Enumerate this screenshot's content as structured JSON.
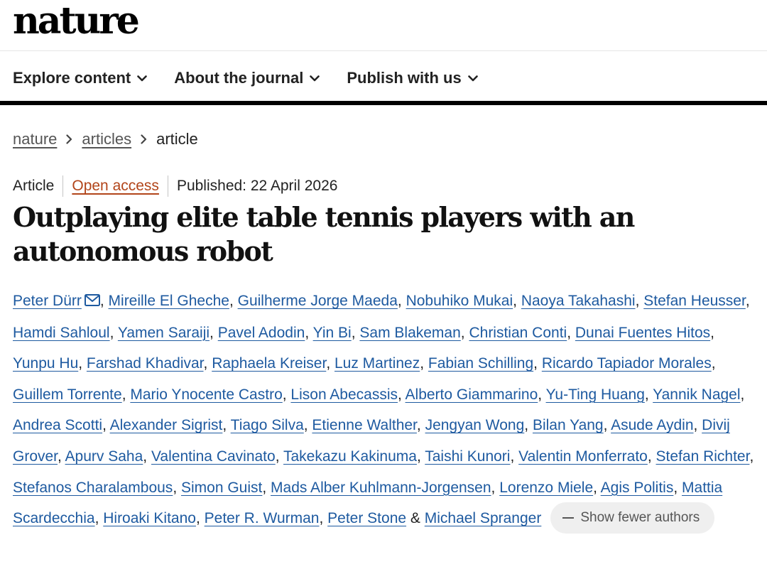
{
  "header": {
    "logo": "nature"
  },
  "nav": {
    "items": [
      {
        "label": "Explore content",
        "icon": "chevron-down-icon"
      },
      {
        "label": "About the journal",
        "icon": "chevron-down-icon"
      },
      {
        "label": "Publish with us",
        "icon": "chevron-down-icon"
      }
    ]
  },
  "breadcrumb": [
    {
      "label": "nature",
      "link": true
    },
    {
      "label": "articles",
      "link": true
    },
    {
      "label": "article",
      "link": false
    }
  ],
  "article": {
    "type": "Article",
    "access": "Open access",
    "published": "Published: 22 April 2026",
    "title": "Outplaying elite table tennis players with an autonomous robot",
    "authors": [
      "Peter Dürr",
      "Mireille El Gheche",
      "Guilherme Jorge Maeda",
      "Nobuhiko Mukai",
      "Naoya Takahashi",
      "Stefan Heusser",
      "Hamdi Sahloul",
      "Yamen Saraiji",
      "Pavel Adodin",
      "Yin Bi",
      "Sam Blakeman",
      "Christian Conti",
      "Dunai Fuentes Hitos",
      "Yunpu Hu",
      "Farshad Khadivar",
      "Raphaela Kreiser",
      "Luz Martinez",
      "Fabian Schilling",
      "Ricardo Tapiador Morales",
      "Guillem Torrente",
      "Mario Ynocente Castro",
      "Lison Abecassis",
      "Alberto Giammarino",
      "Yu-Ting Huang",
      "Yannik Nagel",
      "Andrea Scotti",
      "Alexander Sigrist",
      "Tiago Silva",
      "Etienne Walther",
      "Jengyan Wong",
      "Bilan Yang",
      "Asude Aydin",
      "Divij Grover",
      "Apurv Saha",
      "Valentina Cavinato",
      "Takekazu Kakinuma",
      "Taishi Kunori",
      "Valentin Monferrato",
      "Stefan Richter",
      "Stefanos Charalambous",
      "Simon Guist",
      "Mads Alber Kuhlmann-Jorgensen",
      "Lorenzo Miele",
      "Agis Politis",
      "Mattia Scardecchia",
      "Hiroaki Kitano",
      "Peter R. Wurman",
      "Peter Stone",
      "Michael Spranger"
    ],
    "corresponding_author_icon": "mail-icon",
    "show_fewer_label": "Show fewer authors"
  },
  "colors": {
    "author_link": "#1e5aa0",
    "open_access": "#b2451a",
    "nav_rule": "#000000",
    "button_bg": "#efefef"
  }
}
